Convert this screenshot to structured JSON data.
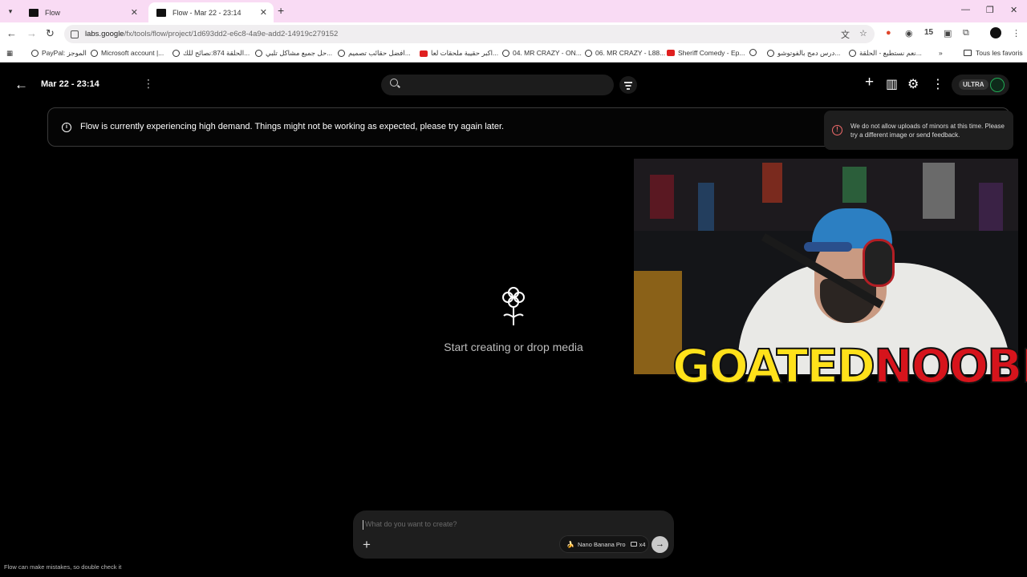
{
  "browser": {
    "tabs": [
      {
        "title": "Flow",
        "active": false
      },
      {
        "title": "Flow - Mar 22 - 23:14",
        "active": true
      }
    ],
    "url_host": "labs.google",
    "url_path": "/fx/tools/flow/project/1d693dd2-e6c8-4a9e-add2-14919c279152",
    "extension_badge": "15",
    "bookmarks": [
      {
        "label": "PayPal: الموجز",
        "icon": "globe-icon"
      },
      {
        "label": "Microsoft account |...",
        "icon": "globe-icon"
      },
      {
        "label": "الحلقة 874:نصائح للك...",
        "icon": "globe-icon"
      },
      {
        "label": "حل جميع مشاكل تلبي...",
        "icon": "globe-icon"
      },
      {
        "label": "افضل حقائب تصميم...",
        "icon": "globe-icon"
      },
      {
        "label": "اكبر حقيبة ملحقات لعا...",
        "icon": "youtube-icon"
      },
      {
        "label": "04. MR CRAZY - ON...",
        "icon": "globe-icon"
      },
      {
        "label": "06. MR CRAZY - L88...",
        "icon": "globe-icon"
      },
      {
        "label": "Sheriff Comedy - Ep...",
        "icon": "youtube-icon"
      },
      {
        "label": "",
        "icon": "globe-icon"
      },
      {
        "label": "درس دمج بالفوتوشو...",
        "icon": "globe-icon"
      },
      {
        "label": "نعم نستطيع - الحلقة...",
        "icon": "globe-icon"
      }
    ],
    "overflow": "»",
    "all_bookmarks": "Tous les favoris"
  },
  "app": {
    "project_title": "Mar 22 - 23:14",
    "plan_badge": "ULTRA",
    "banner_message": "Flow is currently experiencing high demand. Things might not be working as expected, please try again later.",
    "toast_message": "We do not allow uploads of minors at this time. Please try a different image or send feedback.",
    "empty_state": "Start creating or drop media",
    "prompt_placeholder": "What do you want to create?",
    "model_name": "Nano Banana Pro",
    "output_count": "x4",
    "footer_note": "Flow can make mistakes, so double check it",
    "overlay_text_1": "GOATED",
    "overlay_text_2": "NOOBIE"
  }
}
